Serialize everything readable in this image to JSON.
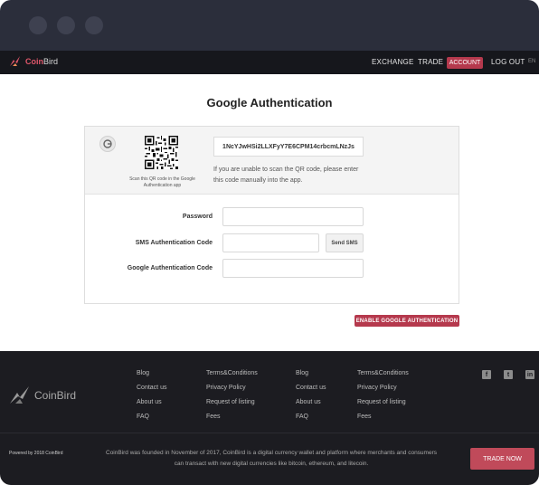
{
  "nav": {
    "brand_name_a": "Coin",
    "brand_name_b": "Bird",
    "exchange": "EXCHANGE",
    "trade": "TRADE",
    "account": "ACCOUNT",
    "logout": "LOG OUT",
    "lang": "EN"
  },
  "page": {
    "title": "Google Authentication"
  },
  "qr_section": {
    "caption": "Scan this QR code in the Google Authentication app",
    "secret_code": "1NcYJwHSi2LLXFyY7E6CPM14crbcmLNzJs",
    "help_text": "If you are unable to scan the QR code, please enter this code manually into the app."
  },
  "form": {
    "password_label": "Password",
    "sms_label": "SMS Authentication Code",
    "send_sms": "Send SMS",
    "google_label": "Google Authentication Code",
    "password_value": "",
    "sms_value": "",
    "google_value": ""
  },
  "enable_button": "ENABLE GOOGLE AUTHENTICATION",
  "footer": {
    "brand": "CoinBird",
    "col1": [
      "Blog",
      "Contact us",
      "About us",
      "FAQ"
    ],
    "col2": [
      "Terms&Conditions",
      "Privacy Policy",
      "Request of listing",
      "Fees"
    ],
    "col3": [
      "Blog",
      "Contact us",
      "About us",
      "FAQ"
    ],
    "col4": [
      "Terms&Conditions",
      "Privacy Policy",
      "Request of listing",
      "Fees"
    ],
    "social": [
      "facebook-icon",
      "twitter-icon",
      "linkedin-icon"
    ],
    "powered": "Powered by 2018 CoinBird",
    "about": "CoinBird was founded in November of 2017, CoinBird is a digital currency wallet and platform where merchants and consumers can transact with new digital currencies like bitcoin, ethereum, and litecoin.",
    "trade_now": "TRADE NOW"
  },
  "colors": {
    "accent": "#b5394d",
    "nav_bg": "#16171c",
    "footer_bg": "#1c1c21",
    "chrome_bg": "#2b2e3b"
  }
}
